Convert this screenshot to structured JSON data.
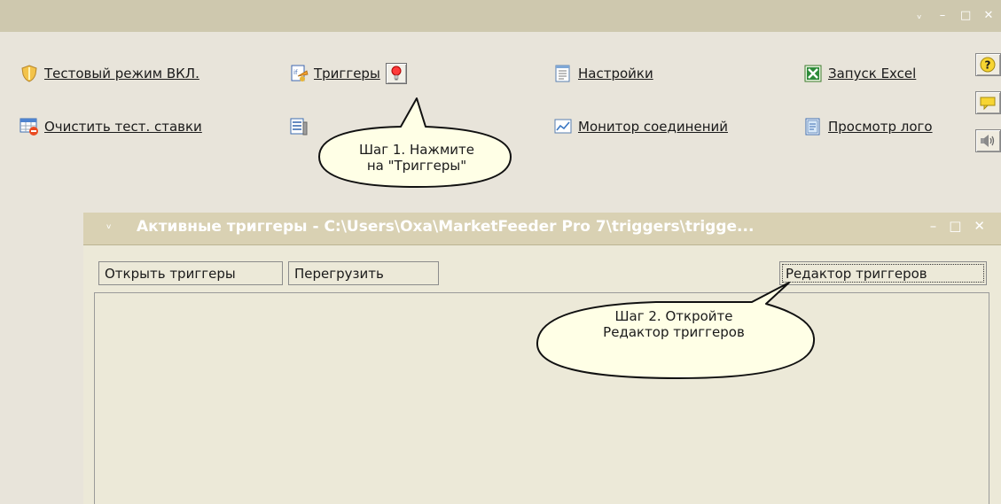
{
  "app": {
    "window_controls": [
      "ᵥ",
      "–",
      "□",
      "✕"
    ]
  },
  "toolbar": {
    "row1": [
      {
        "label": "Тестовый режим ВКЛ.",
        "icon": "shield-icon"
      },
      {
        "label": "Триггеры",
        "icon": "triggers-icon"
      },
      {
        "label": "Настройки",
        "icon": "settings-icon"
      },
      {
        "label": "Запуск Excel",
        "icon": "excel-icon"
      }
    ],
    "row2": [
      {
        "label": "Очистить тест. ставки",
        "icon": "clear-bets-icon"
      },
      {
        "label": "Монитор соединений",
        "icon": "connection-monitor-icon"
      },
      {
        "label": "Просмотр лого",
        "icon": "log-viewer-icon"
      }
    ],
    "side_buttons": [
      "help-icon",
      "comment-icon",
      "sound-icon"
    ]
  },
  "callouts": {
    "step1": {
      "line1": "Шаг 1. Нажмите",
      "line2": "на \"Триггеры\""
    },
    "step2": {
      "line1": "Шаг 2. Откройте",
      "line2": "Редактор триггеров"
    }
  },
  "triggers_window": {
    "title": "Активные триггеры - C:\\Users\\Oxa\\MarketFeeder Pro 7\\triggers\\trigge...",
    "controls": [
      "–",
      "□",
      "✕"
    ],
    "buttons": {
      "open": "Открыть триггеры",
      "reload": "Перегрузить",
      "editor": "Редактор триггеров"
    }
  },
  "colors": {
    "title_bar": "#d9d1b3",
    "background": "#e8e4da",
    "link": "#1a1a1a"
  }
}
